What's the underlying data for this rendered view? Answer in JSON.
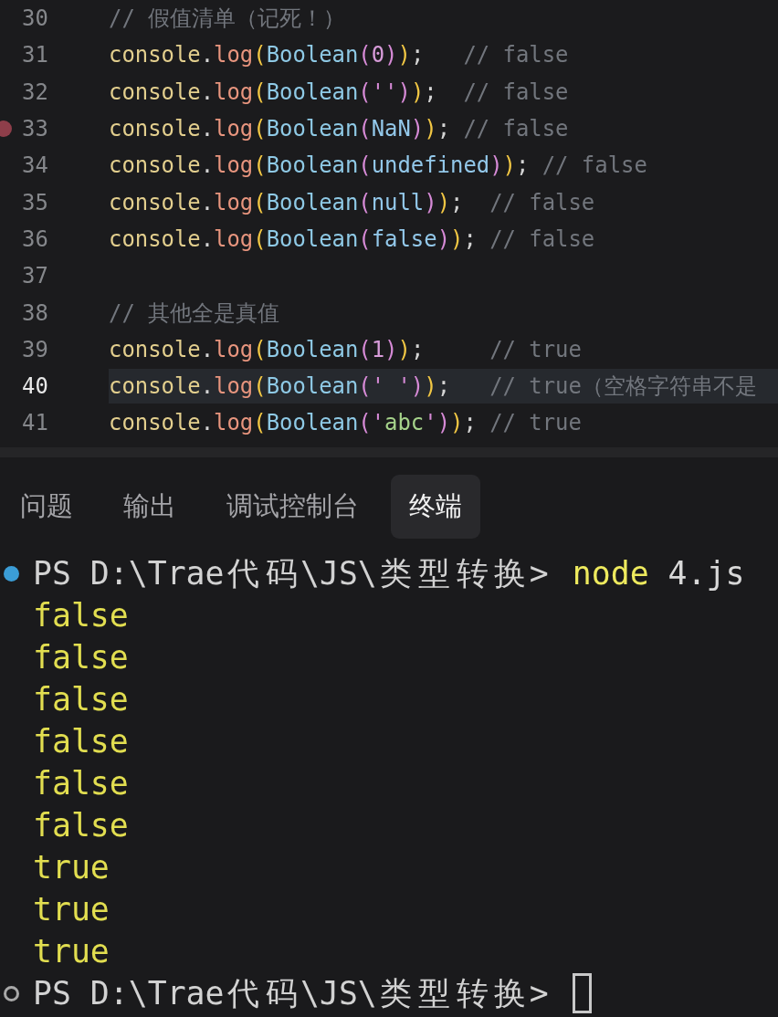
{
  "editor": {
    "lines": [
      {
        "number": "30",
        "current": false,
        "breakpoint": false,
        "tokens": [
          {
            "kind": "comment",
            "text": "// 假值清单（记死！）"
          }
        ]
      },
      {
        "number": "31",
        "current": false,
        "breakpoint": false,
        "tokens": [
          {
            "kind": "object",
            "text": "console"
          },
          {
            "kind": "punct",
            "text": "."
          },
          {
            "kind": "method",
            "text": "log"
          },
          {
            "kind": "bracket1",
            "text": "("
          },
          {
            "kind": "class",
            "text": "Boolean"
          },
          {
            "kind": "bracket2",
            "text": "("
          },
          {
            "kind": "number",
            "text": "0"
          },
          {
            "kind": "bracket2",
            "text": ")"
          },
          {
            "kind": "bracket1",
            "text": ")"
          },
          {
            "kind": "punct",
            "text": ";"
          },
          {
            "kind": "comment",
            "text": "   // false"
          }
        ]
      },
      {
        "number": "32",
        "current": false,
        "breakpoint": false,
        "tokens": [
          {
            "kind": "object",
            "text": "console"
          },
          {
            "kind": "punct",
            "text": "."
          },
          {
            "kind": "method",
            "text": "log"
          },
          {
            "kind": "bracket1",
            "text": "("
          },
          {
            "kind": "class",
            "text": "Boolean"
          },
          {
            "kind": "bracket2",
            "text": "("
          },
          {
            "kind": "quote",
            "text": "''"
          },
          {
            "kind": "bracket2",
            "text": ")"
          },
          {
            "kind": "bracket1",
            "text": ")"
          },
          {
            "kind": "punct",
            "text": ";"
          },
          {
            "kind": "comment",
            "text": "  // false"
          }
        ]
      },
      {
        "number": "33",
        "current": false,
        "breakpoint": true,
        "tokens": [
          {
            "kind": "object",
            "text": "console"
          },
          {
            "kind": "punct",
            "text": "."
          },
          {
            "kind": "method",
            "text": "log"
          },
          {
            "kind": "bracket1",
            "text": "("
          },
          {
            "kind": "class",
            "text": "Boolean"
          },
          {
            "kind": "bracket2",
            "text": "("
          },
          {
            "kind": "literal",
            "text": "NaN"
          },
          {
            "kind": "bracket2",
            "text": ")"
          },
          {
            "kind": "bracket1",
            "text": ")"
          },
          {
            "kind": "punct",
            "text": ";"
          },
          {
            "kind": "comment",
            "text": " // false"
          }
        ]
      },
      {
        "number": "34",
        "current": false,
        "breakpoint": false,
        "tokens": [
          {
            "kind": "object",
            "text": "console"
          },
          {
            "kind": "punct",
            "text": "."
          },
          {
            "kind": "method",
            "text": "log"
          },
          {
            "kind": "bracket1",
            "text": "("
          },
          {
            "kind": "class",
            "text": "Boolean"
          },
          {
            "kind": "bracket2",
            "text": "("
          },
          {
            "kind": "literal",
            "text": "undefined"
          },
          {
            "kind": "bracket2",
            "text": ")"
          },
          {
            "kind": "bracket1",
            "text": ")"
          },
          {
            "kind": "punct",
            "text": ";"
          },
          {
            "kind": "comment",
            "text": " // false"
          }
        ]
      },
      {
        "number": "35",
        "current": false,
        "breakpoint": false,
        "tokens": [
          {
            "kind": "object",
            "text": "console"
          },
          {
            "kind": "punct",
            "text": "."
          },
          {
            "kind": "method",
            "text": "log"
          },
          {
            "kind": "bracket1",
            "text": "("
          },
          {
            "kind": "class",
            "text": "Boolean"
          },
          {
            "kind": "bracket2",
            "text": "("
          },
          {
            "kind": "literal",
            "text": "null"
          },
          {
            "kind": "bracket2",
            "text": ")"
          },
          {
            "kind": "bracket1",
            "text": ")"
          },
          {
            "kind": "punct",
            "text": ";"
          },
          {
            "kind": "comment",
            "text": "  // false"
          }
        ]
      },
      {
        "number": "36",
        "current": false,
        "breakpoint": false,
        "tokens": [
          {
            "kind": "object",
            "text": "console"
          },
          {
            "kind": "punct",
            "text": "."
          },
          {
            "kind": "method",
            "text": "log"
          },
          {
            "kind": "bracket1",
            "text": "("
          },
          {
            "kind": "class",
            "text": "Boolean"
          },
          {
            "kind": "bracket2",
            "text": "("
          },
          {
            "kind": "literal",
            "text": "false"
          },
          {
            "kind": "bracket2",
            "text": ")"
          },
          {
            "kind": "bracket1",
            "text": ")"
          },
          {
            "kind": "punct",
            "text": ";"
          },
          {
            "kind": "comment",
            "text": " // false"
          }
        ]
      },
      {
        "number": "37",
        "current": false,
        "breakpoint": false
      },
      {
        "number": "38",
        "current": false,
        "breakpoint": false,
        "tokens": [
          {
            "kind": "comment",
            "text": "// 其他全是真值"
          }
        ]
      },
      {
        "number": "39",
        "current": false,
        "breakpoint": false,
        "tokens": [
          {
            "kind": "object",
            "text": "console"
          },
          {
            "kind": "punct",
            "text": "."
          },
          {
            "kind": "method",
            "text": "log"
          },
          {
            "kind": "bracket1",
            "text": "("
          },
          {
            "kind": "class",
            "text": "Boolean"
          },
          {
            "kind": "bracket2",
            "text": "("
          },
          {
            "kind": "number",
            "text": "1"
          },
          {
            "kind": "bracket2",
            "text": ")"
          },
          {
            "kind": "bracket1",
            "text": ")"
          },
          {
            "kind": "punct",
            "text": ";"
          },
          {
            "kind": "comment",
            "text": "     // true"
          }
        ]
      },
      {
        "number": "40",
        "current": true,
        "breakpoint": false,
        "tokens": [
          {
            "kind": "object",
            "text": "console"
          },
          {
            "kind": "punct",
            "text": "."
          },
          {
            "kind": "method",
            "text": "log"
          },
          {
            "kind": "bracket1",
            "text": "("
          },
          {
            "kind": "class",
            "text": "Boolean"
          },
          {
            "kind": "bracket2",
            "text": "("
          },
          {
            "kind": "quote",
            "text": "' '"
          },
          {
            "kind": "bracket2",
            "text": ")"
          },
          {
            "kind": "bracket1",
            "text": ")"
          },
          {
            "kind": "punct",
            "text": ";"
          },
          {
            "kind": "comment",
            "text": "   // true（空格字符串不是"
          }
        ]
      },
      {
        "number": "41",
        "current": false,
        "breakpoint": false,
        "tokens": [
          {
            "kind": "object",
            "text": "console"
          },
          {
            "kind": "punct",
            "text": "."
          },
          {
            "kind": "method",
            "text": "log"
          },
          {
            "kind": "bracket1",
            "text": "("
          },
          {
            "kind": "class",
            "text": "Boolean"
          },
          {
            "kind": "bracket2",
            "text": "("
          },
          {
            "kind": "quote",
            "text": "'"
          },
          {
            "kind": "string",
            "text": "abc"
          },
          {
            "kind": "quote",
            "text": "'"
          },
          {
            "kind": "bracket2",
            "text": ")"
          },
          {
            "kind": "bracket1",
            "text": ")"
          },
          {
            "kind": "punct",
            "text": ";"
          },
          {
            "kind": "comment",
            "text": " // true"
          }
        ]
      }
    ]
  },
  "panel": {
    "tabs": [
      {
        "label": "问题",
        "selected": false
      },
      {
        "label": "输出",
        "selected": false
      },
      {
        "label": "调试控制台",
        "selected": false
      },
      {
        "label": "终端",
        "selected": true
      }
    ]
  },
  "terminal": {
    "lines": [
      {
        "kind": "prompt",
        "finished": true,
        "cursor": false,
        "path": "PS D:\\Trae代码\\JS\\类型转换>",
        "command": "node",
        "args": "4.js"
      },
      {
        "kind": "output",
        "text": "false"
      },
      {
        "kind": "output",
        "text": "false"
      },
      {
        "kind": "output",
        "text": "false"
      },
      {
        "kind": "output",
        "text": "false"
      },
      {
        "kind": "output",
        "text": "false"
      },
      {
        "kind": "output",
        "text": "false"
      },
      {
        "kind": "output",
        "text": "true"
      },
      {
        "kind": "output",
        "text": "true"
      },
      {
        "kind": "output",
        "text": "true"
      },
      {
        "kind": "prompt",
        "finished": false,
        "cursor": true,
        "path": "PS D:\\Trae代码\\JS\\类型转换>"
      }
    ]
  }
}
